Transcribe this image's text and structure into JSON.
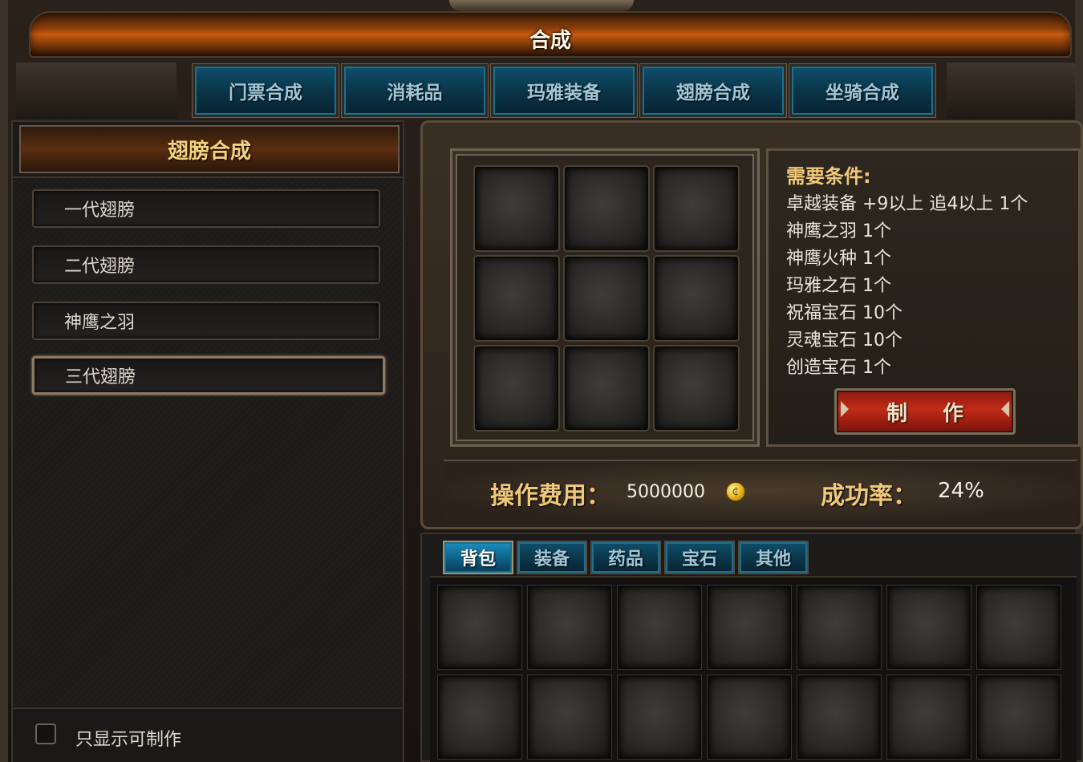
{
  "window": {
    "title": "合成"
  },
  "top_tabs": [
    {
      "label": "门票合成"
    },
    {
      "label": "消耗品"
    },
    {
      "label": "玛雅装备"
    },
    {
      "label": "翅膀合成"
    },
    {
      "label": "坐骑合成"
    }
  ],
  "left_panel": {
    "header": "翅膀合成",
    "items": [
      {
        "label": "一代翅膀"
      },
      {
        "label": "二代翅膀"
      },
      {
        "label": "神鹰之羽"
      },
      {
        "label": "三代翅膀",
        "selected": true
      }
    ],
    "filter_checkbox": {
      "label": "只显示可制作",
      "checked": false
    }
  },
  "requirements": {
    "title": "需要条件:",
    "lines": [
      {
        "text": "卓越装备 +9以上 追4以上 1个"
      },
      {
        "text": "神鹰之羽  1个"
      },
      {
        "text": "神鹰火种  1个"
      },
      {
        "text": "玛雅之石  1个"
      },
      {
        "text": "祝福宝石  10个"
      },
      {
        "text": "灵魂宝石  10个"
      },
      {
        "text": "创造宝石  1个"
      }
    ],
    "make_button": "制作"
  },
  "cost": {
    "label": "操作费用：",
    "value": "5000000",
    "currency_icon": "gold-coin-icon"
  },
  "success": {
    "label": "成功率：",
    "value": "24%"
  },
  "inventory": {
    "tabs": [
      {
        "label": "背包",
        "active": true
      },
      {
        "label": "装备"
      },
      {
        "label": "药品"
      },
      {
        "label": "宝石"
      },
      {
        "label": "其他"
      }
    ]
  },
  "colors": {
    "gold_text": "#f0c879",
    "tab_blue": "#0a3346",
    "make_button_red": "#c22a18",
    "title_orange": "#c95a10"
  }
}
